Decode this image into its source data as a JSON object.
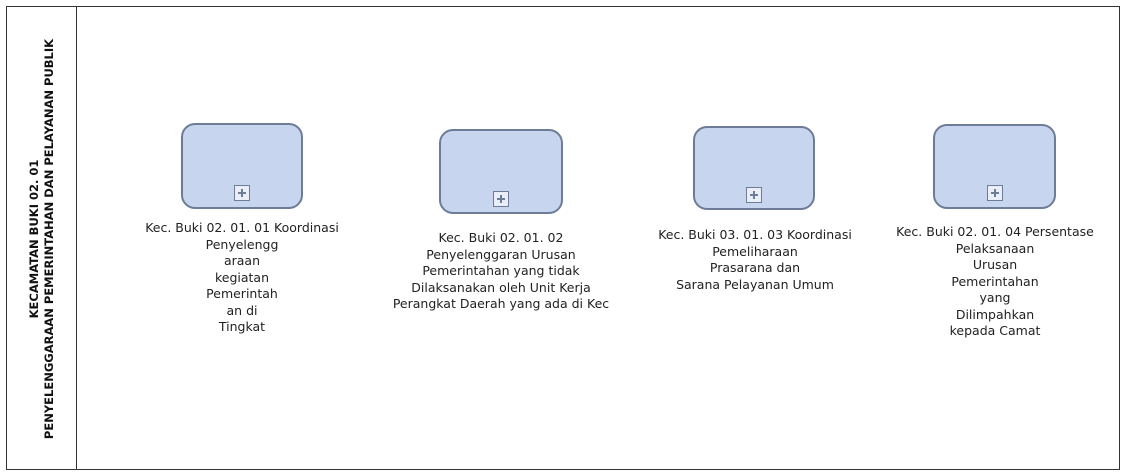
{
  "lane": {
    "title_line1": "KECAMATAN BUKI 02. 01",
    "title_line2": "PENYELENGGARAAN PEMERINTAHAN DAN PELAYANAN PUBLIK"
  },
  "tasks": [
    {
      "lines": [
        "Kec. Buki 02. 01. 01 Koordinasi",
        "Penyelengg",
        "araan",
        "kegiatan",
        "Pemerintah",
        "an di",
        "Tingkat"
      ]
    },
    {
      "lines": [
        "Kec. Buki 02. 01. 02",
        "Penyelenggaran Urusan",
        "Pemerintahan yang tidak",
        "Dilaksanakan oleh Unit Kerja",
        "Perangkat Daerah yang ada di  Kec"
      ]
    },
    {
      "lines": [
        "Kec. Buki 03. 01. 03 Koordinasi",
        "Pemeliharaan",
        "Prasarana dan",
        "Sarana Pelayanan Umum"
      ]
    },
    {
      "lines": [
        "Kec. Buki 02. 01. 04 Persentase",
        "Pelaksanaan",
        "Urusan",
        "Pemerintahan",
        "yang",
        "Dilimpahkan",
        "kepada Camat"
      ]
    }
  ],
  "icons": {
    "subprocess_marker": "plus-square-icon"
  },
  "colors": {
    "task_fill": "#c7d6ee",
    "task_stroke": "#6d7d98",
    "border": "#333333"
  }
}
